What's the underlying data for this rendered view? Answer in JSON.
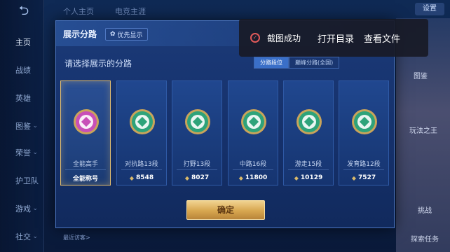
{
  "top_tabs": [
    "个人主页",
    "电竞主涯"
  ],
  "top_right": "设置",
  "sidebar": {
    "back_icon": "back-arrow-icon",
    "items": [
      {
        "label": "主页",
        "active": true
      },
      {
        "label": "战绩"
      },
      {
        "label": "英雄"
      },
      {
        "label": "图鉴",
        "chevron": true
      },
      {
        "label": "荣誉",
        "chevron": true
      },
      {
        "label": "护卫队",
        "chevron": true
      },
      {
        "label": "游戏",
        "chevron": true
      },
      {
        "label": "社交",
        "chevron": true
      }
    ]
  },
  "modal": {
    "title": "展示分路",
    "priority_label": "优先显示",
    "subtitle": "请选择展示的分路",
    "tabs": [
      "分路段位",
      "巅峰分路(全国)"
    ],
    "selected_tab": 0,
    "confirm_label": "确定",
    "bottom_left": "最近访客>"
  },
  "cards": [
    {
      "label": "全能高手",
      "value": "全能称号",
      "emblem": "all-round-emblem-icon",
      "color": "#c84fb8",
      "selected": true,
      "diamond": false
    },
    {
      "label": "对抗路13段",
      "value": "8548",
      "emblem": "clash-lane-emblem-icon",
      "color": "#2ea37a",
      "diamond": true
    },
    {
      "label": "打野13段",
      "value": "8027",
      "emblem": "jungle-emblem-icon",
      "color": "#2ea37a",
      "diamond": true
    },
    {
      "label": "中路16段",
      "value": "11800",
      "emblem": "mid-lane-emblem-icon",
      "color": "#2ea37a",
      "diamond": true
    },
    {
      "label": "游走15段",
      "value": "10129",
      "emblem": "roam-emblem-icon",
      "color": "#2ea37a",
      "diamond": true
    },
    {
      "label": "发育路12段",
      "value": "7527",
      "emblem": "farm-lane-emblem-icon",
      "color": "#2ea37a",
      "diamond": true
    }
  ],
  "toast": {
    "message": "截图成功",
    "actions": [
      "打开目录",
      "查看文件"
    ],
    "accent": "#e05a5a"
  },
  "right_bg_text": [
    "图鉴",
    "玩法之王",
    "挑战",
    "探索任务"
  ]
}
